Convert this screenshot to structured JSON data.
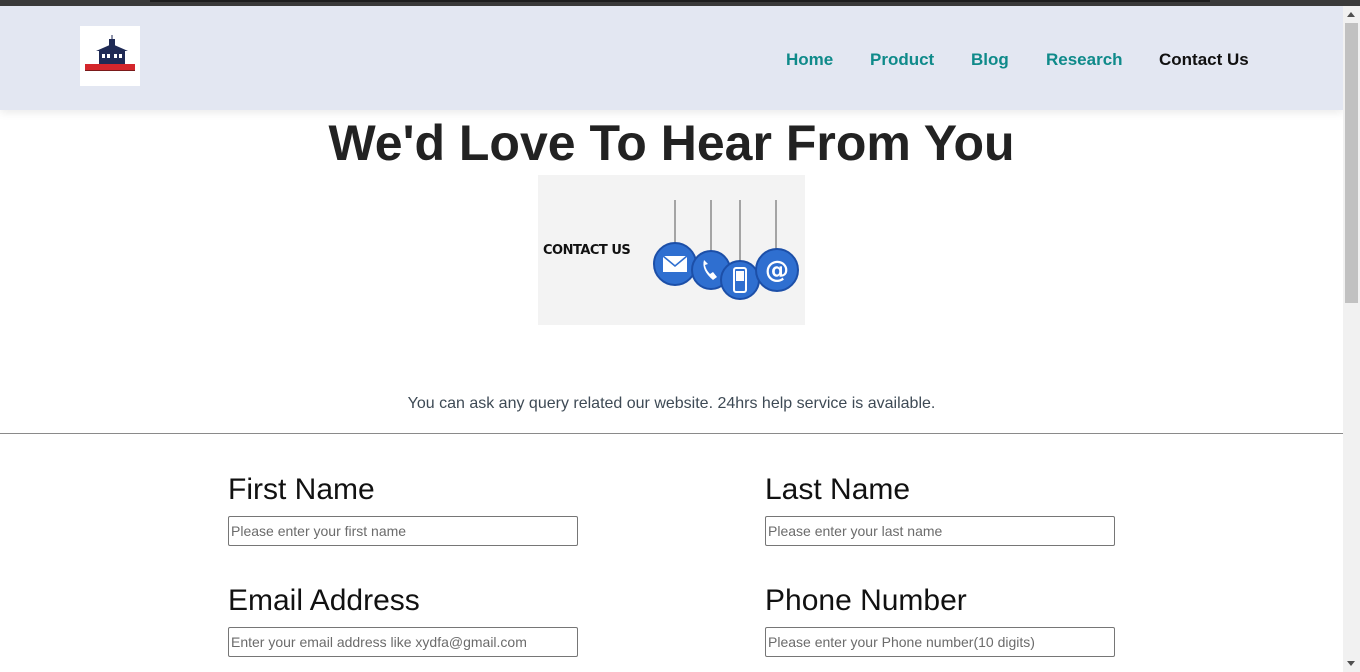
{
  "nav": {
    "items": [
      {
        "label": "Home",
        "active": false
      },
      {
        "label": "Product",
        "active": false
      },
      {
        "label": "Blog",
        "active": false
      },
      {
        "label": "Research",
        "active": false
      },
      {
        "label": "Contact Us",
        "active": true
      }
    ]
  },
  "hero": {
    "title": "We'd Love To Hear From You",
    "image_caption": "CONTACT US",
    "image_icons": [
      "envelope-icon",
      "phone-icon",
      "mobile-icon",
      "at-sign-icon"
    ]
  },
  "intro_text": "You can ask any query related our website. 24hrs help service is available.",
  "form": {
    "first_name": {
      "label": "First Name",
      "placeholder": "Please enter your first name"
    },
    "last_name": {
      "label": "Last Name",
      "placeholder": "Please enter your last name"
    },
    "email": {
      "label": "Email Address",
      "placeholder": "Enter your email address like xydfa@gmail.com"
    },
    "phone": {
      "label": "Phone Number",
      "placeholder": "Please enter your Phone number(10 digits)"
    }
  },
  "colors": {
    "header_bg": "#e3e7f2",
    "nav_link": "#0f8a8a",
    "nav_active": "#111111",
    "icon_blue": "#2f6fd0"
  }
}
